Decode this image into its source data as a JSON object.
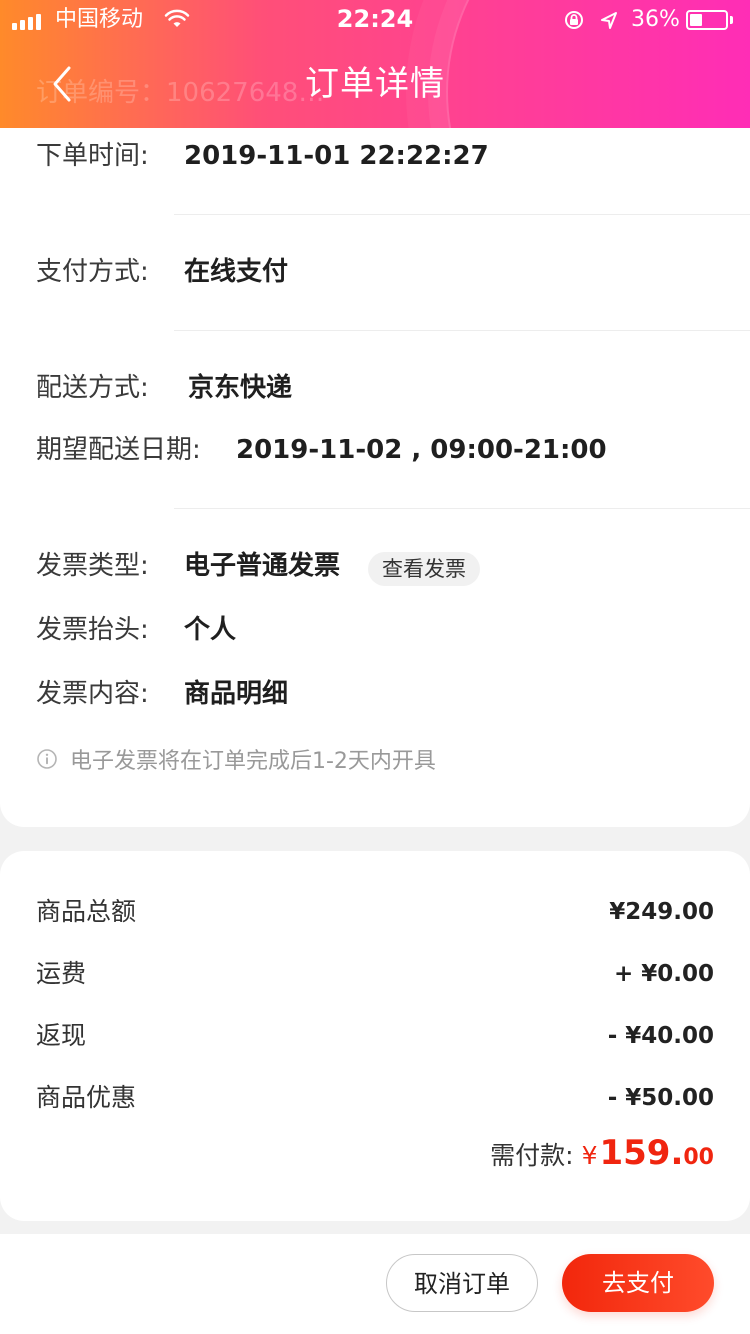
{
  "status_bar": {
    "carrier": "中国移动",
    "time": "22:24",
    "battery_text": "36%",
    "battery_level": 0.36
  },
  "header": {
    "title": "订单详情",
    "ghost_text": "订单编号：10627648…"
  },
  "order_info": {
    "order_time_label": "下单时间:",
    "order_time_value": "2019-11-01 22:22:27",
    "payment_method_label": "支付方式:",
    "payment_method_value": "在线支付",
    "delivery_method_label": "配送方式:",
    "delivery_method_value": "京东快递",
    "expected_date_label": "期望配送日期:",
    "expected_date_value": "2019-11-02 , 09:00-21:00",
    "invoice_type_label": "发票类型:",
    "invoice_type_value": "电子普通发票",
    "view_invoice_button": "查看发票",
    "invoice_title_label": "发票抬头:",
    "invoice_title_value": "个人",
    "invoice_content_label": "发票内容:",
    "invoice_content_value": "商品明细",
    "invoice_note": "电子发票将在订单完成后1-2天内开具"
  },
  "summary": {
    "items_total_label": "商品总额",
    "items_total_value": "¥249.00",
    "shipping_label": "运费",
    "shipping_value": "+ ¥0.00",
    "cashback_label": "返现",
    "cashback_value": "- ¥40.00",
    "discount_label": "商品优惠",
    "discount_value": "- ¥50.00",
    "amount_due_label": "需付款:",
    "amount_due_currency": "¥",
    "amount_due_integer": "159.",
    "amount_due_decimal": "00"
  },
  "footer": {
    "cancel_order_button": "取消订单",
    "pay_button": "去支付"
  },
  "colors": {
    "accent": "#f0250f",
    "header_gradient_start": "#ff8a2a",
    "header_gradient_end": "#ff2db6"
  },
  "icons": {
    "back": "chevron-left-icon",
    "wifi": "wifi-icon",
    "lock": "orientation-lock-icon",
    "location": "location-arrow-icon",
    "info": "info-icon"
  }
}
